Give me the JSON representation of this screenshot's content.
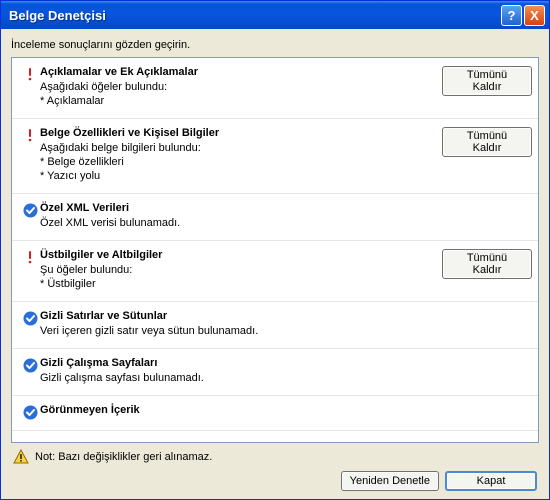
{
  "titlebar": {
    "title": "Belge Denetçisi",
    "help": "?",
    "close": "X"
  },
  "subtitle": "İnceleme sonuçlarını gözden geçirin.",
  "items": [
    {
      "status": "warn",
      "title": "Açıklamalar ve Ek Açıklamalar",
      "detail": "Aşağıdaki öğeler bulundu:\n* Açıklamalar",
      "action": "Tümünü Kaldır"
    },
    {
      "status": "warn",
      "title": "Belge Özellikleri ve Kişisel Bilgiler",
      "detail": "Aşağıdaki belge bilgileri bulundu:\n* Belge özellikleri\n* Yazıcı yolu",
      "action": "Tümünü Kaldır"
    },
    {
      "status": "ok",
      "title": "Özel XML Verileri",
      "detail": "Özel XML verisi bulunamadı.",
      "action": null
    },
    {
      "status": "warn",
      "title": "Üstbilgiler ve Altbilgiler",
      "detail": "Şu öğeler bulundu:\n* Üstbilgiler",
      "action": "Tümünü Kaldır"
    },
    {
      "status": "ok",
      "title": "Gizli Satırlar ve Sütunlar",
      "detail": "Veri içeren gizli satır veya sütun bulunamadı.",
      "action": null
    },
    {
      "status": "ok",
      "title": "Gizli Çalışma Sayfaları",
      "detail": "Gizli çalışma sayfası bulunamadı.",
      "action": null
    },
    {
      "status": "ok",
      "title": "Görünmeyen İçerik",
      "detail": "",
      "action": null
    }
  ],
  "note": "Not: Bazı değişiklikler geri alınamaz.",
  "footer": {
    "reinspect": "Yeniden Denetle",
    "close": "Kapat"
  }
}
